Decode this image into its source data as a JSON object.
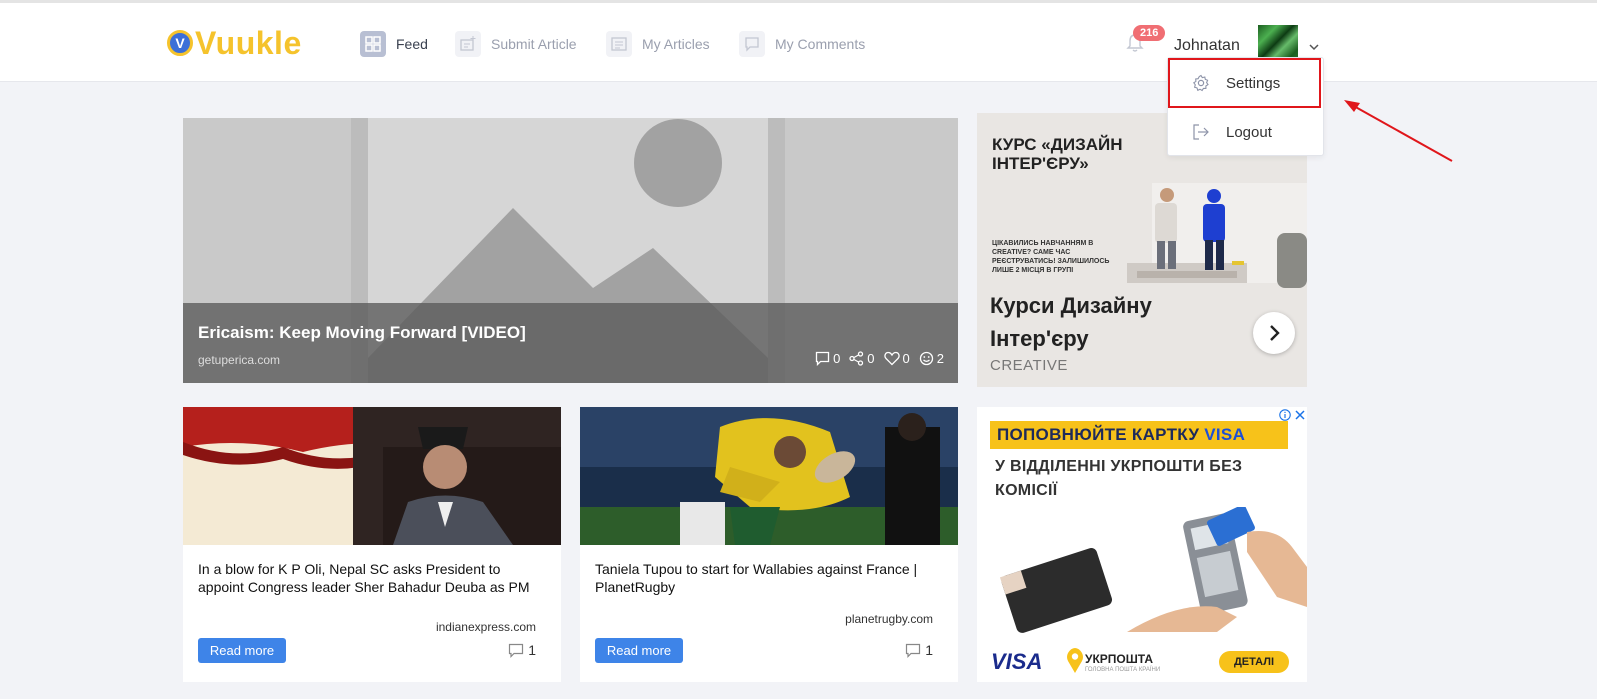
{
  "brand": {
    "badge_letter": "V",
    "name": "Vuukle",
    "color": "#f5c32c"
  },
  "nav": {
    "items": [
      {
        "label": "Feed",
        "icon": "grid-icon",
        "active": true
      },
      {
        "label": "Submit Article",
        "icon": "add-document-icon",
        "active": false
      },
      {
        "label": "My Articles",
        "icon": "document-list-icon",
        "active": false
      },
      {
        "label": "My Comments",
        "icon": "comment-icon",
        "active": false
      }
    ]
  },
  "user": {
    "notifications_count": "216",
    "name": "Johnatan",
    "menu": [
      {
        "label": "Settings",
        "icon": "gear-icon"
      },
      {
        "label": "Logout",
        "icon": "logout-icon"
      }
    ]
  },
  "featured": {
    "title": "Ericaism: Keep Moving Forward [VIDEO]",
    "source": "getuperica.com",
    "stats": {
      "comments": "0",
      "shares": "0",
      "likes": "0",
      "reactions": "2"
    }
  },
  "ad_top": {
    "headline": "КУРС «ДИЗАЙН ІНТЕР'ЄРУ»",
    "small_text": "ЦІКАВИЛИСЬ НАВЧАННЯМ В CREATIVE? САМЕ ЧАС РЕЄСТРУВАТИСЬ! ЗАЛИШИЛОСЬ ЛИШЕ 2 МІСЦЯ В ГРУПІ",
    "title": "Курси Дизайну Інтер'єру",
    "brand": "CREATIVE"
  },
  "cards": [
    {
      "title": "In a blow for K P Oli, Nepal SC asks President to appoint Congress leader Sher Bahadur Deuba as PM",
      "source": "indianexpress.com",
      "read_more": "Read more",
      "comments": "1"
    },
    {
      "title": "Taniela Tupou to start for Wallabies against France | PlanetRugby",
      "source": "planetrugby.com",
      "read_more": "Read more",
      "comments": "1"
    }
  ],
  "ad_bottom": {
    "banner_text": "ПОПОВНЮЙТЕ КАРТКУ",
    "banner_visa": "VISA",
    "subtitle": "У ВІДДІЛЕННІ УКРПОШТИ БЕЗ КОМІСІЇ",
    "visa_logo": "VISA",
    "post_name": "УКРПОШТА",
    "post_sub": "ГОЛОВНА ПОШТА КРАЇНИ",
    "details_button": "ДЕТАЛІ"
  },
  "colors": {
    "accent": "#3e84e8",
    "highlight": "#e0161b",
    "badge": "#f06e73"
  }
}
